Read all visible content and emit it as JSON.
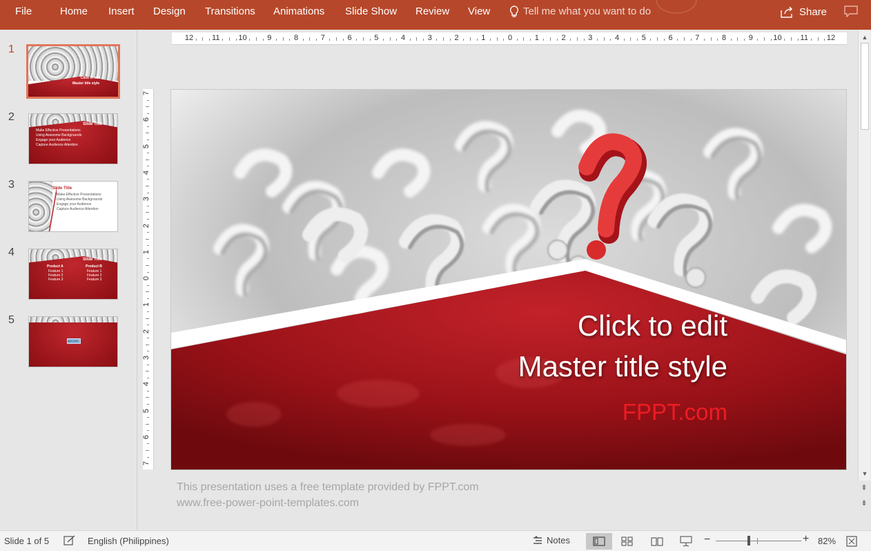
{
  "ribbon": {
    "tabs": [
      "File",
      "Home",
      "Insert",
      "Design",
      "Transitions",
      "Animations",
      "Slide Show",
      "Review",
      "View"
    ],
    "tell_me": "Tell me what you want to do",
    "share": "Share"
  },
  "thumbnails": {
    "numbers": [
      "1",
      "2",
      "3",
      "4",
      "5"
    ],
    "slide1_title": [
      "Click to edit",
      "Master title style"
    ],
    "slide2_title": "Slide Title",
    "slide2_bullets": [
      "Make Effective Presentations",
      "Using Awesome Backgrounds",
      "Engage your Audience",
      "Capture Audience Attention"
    ],
    "slide3_title": "Slide Title",
    "slide3_bullets": [
      "Make Effective Presentations",
      "Using Awesome Backgrounds",
      "Engage your Audience",
      "Capture Audience Attention"
    ],
    "slide4_title": "Slide Title",
    "slide4_col1": "Product A",
    "slide4_col2": "Product B",
    "slide4_items_a": [
      "Feature 1",
      "Feature 2",
      "Feature 3"
    ],
    "slide4_items_b": [
      "Feature 1",
      "Feature 2",
      "Feature 3"
    ],
    "slide5_label": "fppt.com"
  },
  "ruler": {
    "h_labels": [
      "12",
      "11",
      "10",
      "9",
      "8",
      "7",
      "6",
      "5",
      "4",
      "3",
      "2",
      "1",
      "0",
      "1",
      "2",
      "3",
      "4",
      "5",
      "6",
      "7",
      "8",
      "9",
      "10",
      "11",
      "12"
    ],
    "v_labels": [
      "7",
      "6",
      "5",
      "4",
      "3",
      "2",
      "1",
      "0",
      "1",
      "2",
      "3",
      "4",
      "5",
      "6",
      "7"
    ]
  },
  "slide": {
    "title_line1": "Click to edit",
    "title_line2": "Master title style",
    "subtitle": "FPPT.com",
    "accent": "#ee1c24",
    "band_color": "#a7161c"
  },
  "notes": {
    "line1": "This presentation uses a free template provided by FPPT.com",
    "line2": "www.free-power-point-templates.com"
  },
  "status": {
    "slide_indicator": "Slide 1 of 5",
    "language": "English (Philippines)",
    "notes": "Notes",
    "zoom": "82%"
  }
}
